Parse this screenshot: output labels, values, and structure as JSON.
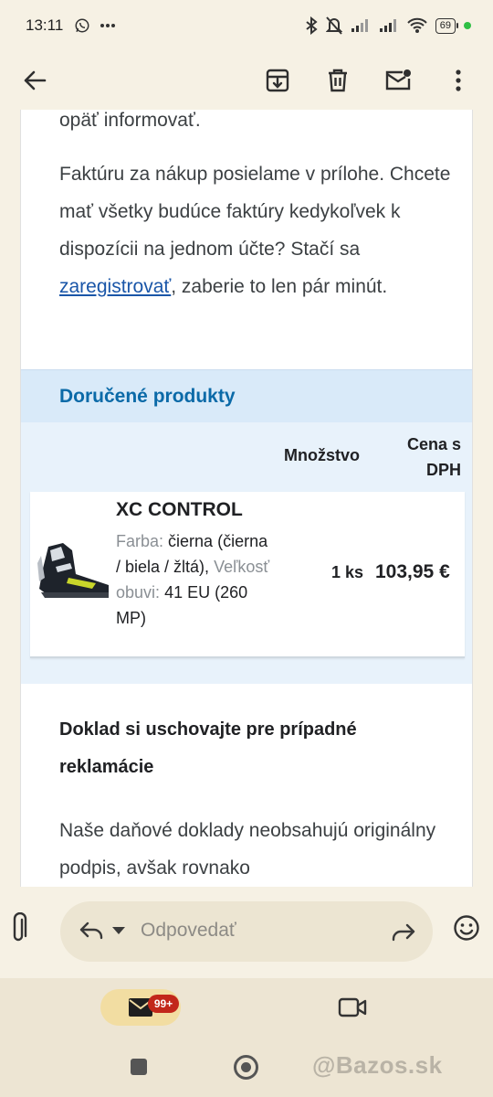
{
  "status_bar": {
    "time": "13:11",
    "battery": "69",
    "icons_left": [
      "whatsapp-icon",
      "more-dots-icon"
    ],
    "icons_right": [
      "bluetooth-icon",
      "bell-off-icon",
      "signal-icon",
      "signal-icon",
      "wifi-icon",
      "battery-icon",
      "green-dot"
    ]
  },
  "app_bar": {
    "icons": [
      "back-arrow-icon",
      "archive-icon",
      "trash-icon",
      "mark-unread-icon",
      "more-vert-icon"
    ]
  },
  "email": {
    "clipped_line": "opäť informovať.",
    "intro_before_link": "Faktúru za nákup posielame v prílohe. Chcete mať všetky budúce faktúry kedykoľvek k dispozícii na jednom účte? Stačí sa ",
    "intro_link": "zaregistrovať",
    "intro_after_link": ", zaberie to len pár minút.",
    "section_title": "Doručené produkty",
    "col_qty": "Množstvo",
    "col_price": "Cena s DPH",
    "product": {
      "name": "XC CONTROL",
      "color_label": "Farba:",
      "color_value": "čierna (čierna / biela / žltá),",
      "size_label": "Veľkosť obuvi:",
      "size_value": "41 EU (260 MP)",
      "qty": "1 ks",
      "price": "103,95 €",
      "colors": {
        "boot": "#1e232b",
        "accent": "#c9d62a"
      }
    },
    "doc_title": "Doklad si uschovajte pre prípadné reklamácie",
    "doc_text": "Naše daňové doklady neobsahujú originálny podpis, avšak rovnako"
  },
  "compose": {
    "placeholder": "Odpovedať",
    "icons": [
      "paperclip-icon",
      "reply-icon",
      "dropdown-icon",
      "forward-icon",
      "emoji-icon"
    ]
  },
  "bottom_nav": {
    "mail_badge": "99+",
    "icons": [
      "mail-icon",
      "video-icon"
    ]
  },
  "system_nav": {
    "watermark": "@Bazos.sk"
  },
  "colors": {
    "app_bg": "#f6f1e4",
    "section_head_bg": "#d9eaf9",
    "section_head_text": "#0b6aa8",
    "link": "#1a56a8",
    "badge": "#c2271a"
  }
}
